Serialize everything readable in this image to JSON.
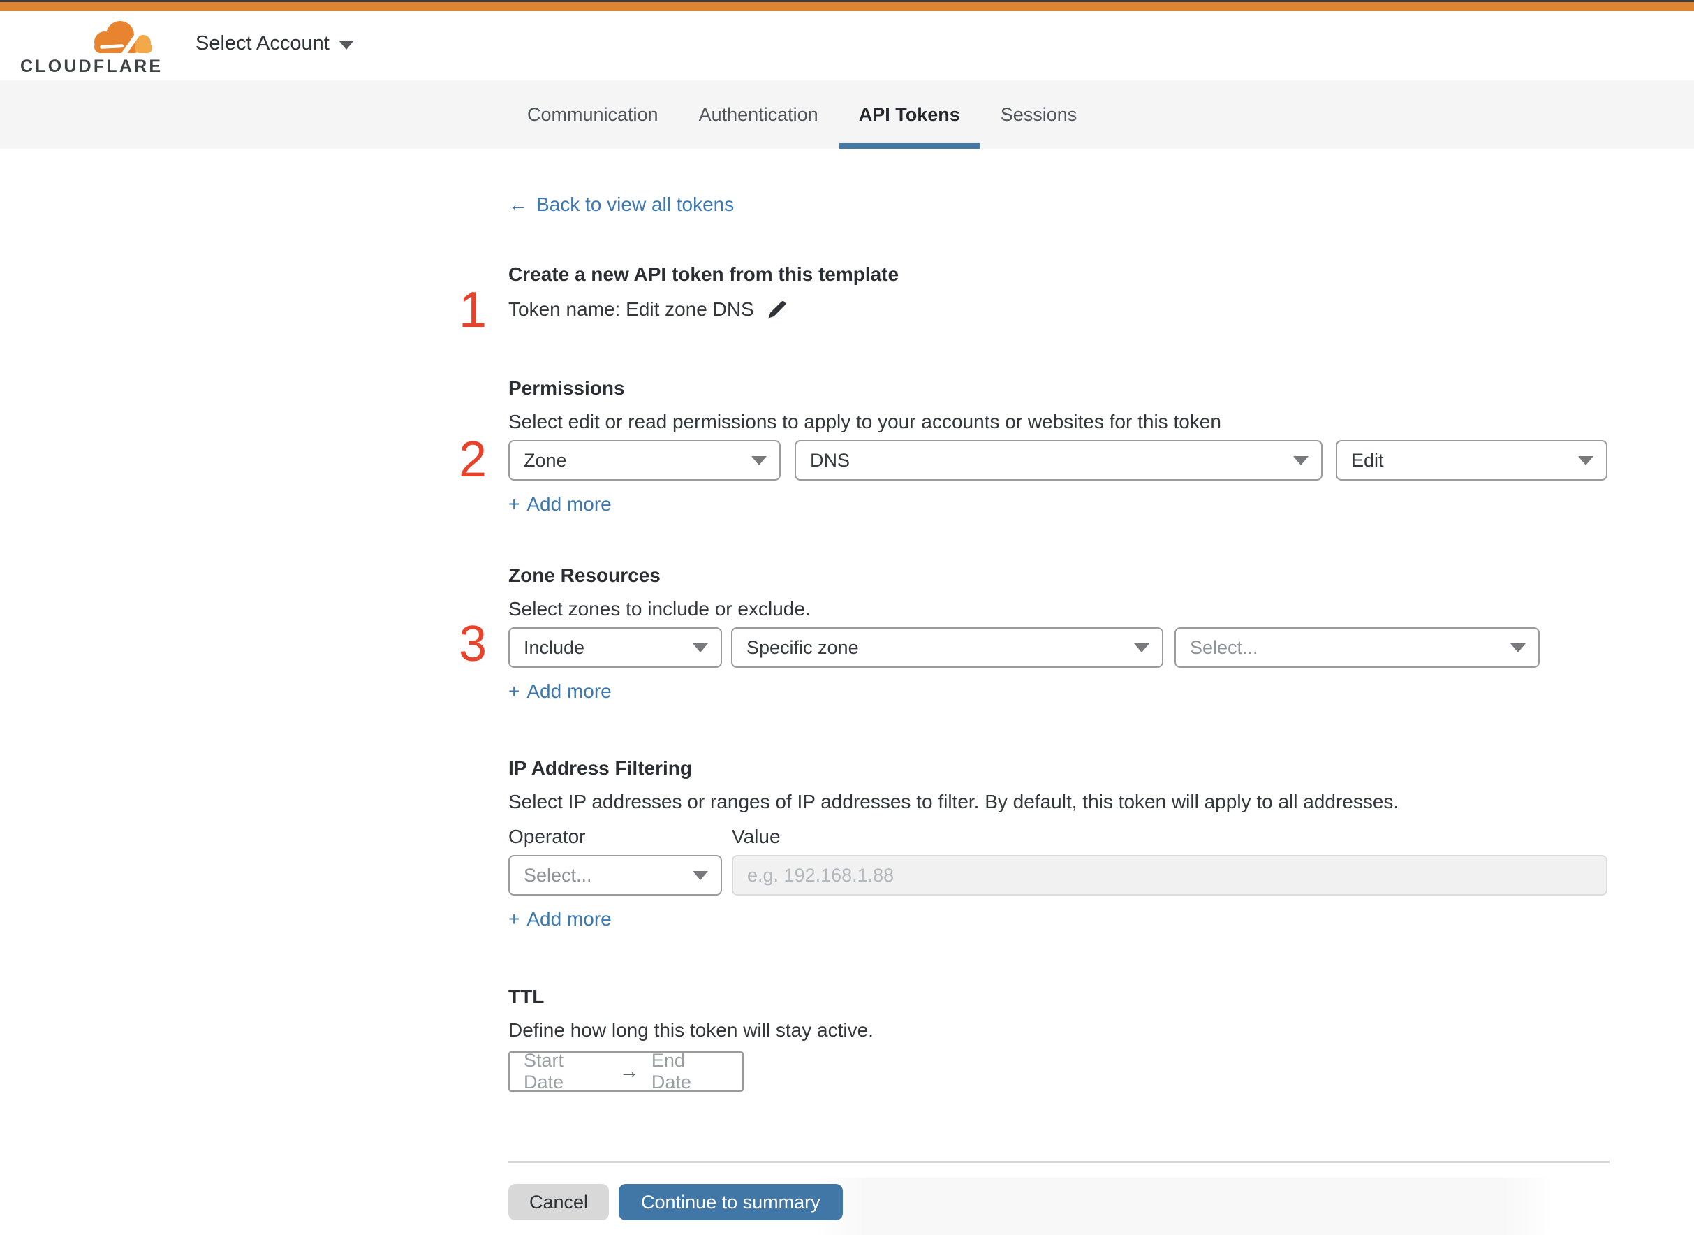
{
  "header": {
    "brand": "CLOUDFLARE",
    "account_selector": "Select Account"
  },
  "tabs": [
    {
      "label": "Communication",
      "active": false
    },
    {
      "label": "Authentication",
      "active": false
    },
    {
      "label": "API Tokens",
      "active": true
    },
    {
      "label": "Sessions",
      "active": false
    }
  ],
  "back_link": {
    "arrow": "←",
    "label": "Back to view all tokens"
  },
  "create": {
    "step": "1",
    "heading": "Create a new API token from this template",
    "token_line": "Token name: Edit zone DNS"
  },
  "permissions": {
    "step": "2",
    "heading": "Permissions",
    "description": "Select edit or read permissions to apply to your accounts or websites for this token",
    "selects": [
      {
        "value": "Zone"
      },
      {
        "value": "DNS"
      },
      {
        "value": "Edit"
      }
    ],
    "add_more": {
      "plus": "+",
      "label": "Add more"
    }
  },
  "zone_resources": {
    "step": "3",
    "heading": "Zone Resources",
    "description": "Select zones to include or exclude.",
    "selects": [
      {
        "value": "Include"
      },
      {
        "value": "Specific zone"
      },
      {
        "value": "Select..."
      }
    ],
    "add_more": {
      "plus": "+",
      "label": "Add more"
    }
  },
  "ip_filtering": {
    "heading": "IP Address Filtering",
    "description": "Select IP addresses or ranges of IP addresses to filter. By default, this token will apply to all addresses.",
    "operator_label": "Operator",
    "value_label": "Value",
    "operator_select": "Select...",
    "value_placeholder": "e.g. 192.168.1.88",
    "add_more": {
      "plus": "+",
      "label": "Add more"
    }
  },
  "ttl": {
    "heading": "TTL",
    "description": "Define how long this token will stay active.",
    "start_placeholder": "Start Date",
    "arrow": "→",
    "end_placeholder": "End Date"
  },
  "actions": {
    "cancel": "Cancel",
    "continue": "Continue to summary"
  },
  "colors": {
    "top_bar_orange": "#dd8435",
    "brand_orange": "#e8842f",
    "brand_light_orange": "#f3a94a",
    "link_blue": "#3d79b0",
    "active_tab_underline": "#4478a6",
    "primary_button_blue": "#4177a7",
    "step_number_red": "#e8432a"
  }
}
